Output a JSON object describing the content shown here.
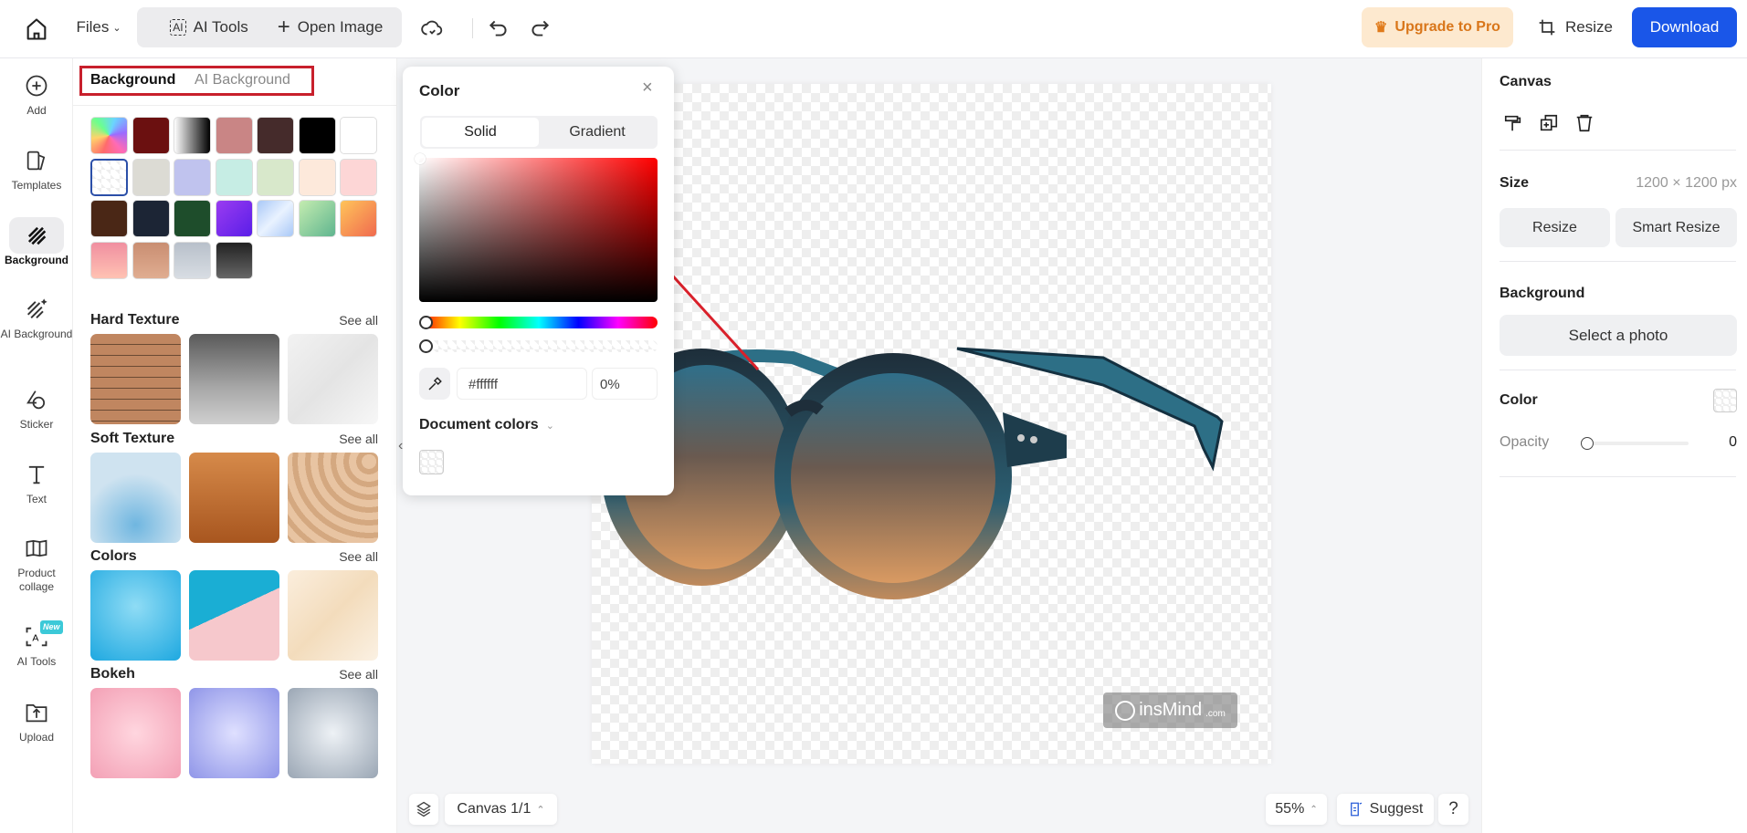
{
  "header": {
    "files": "Files",
    "ai_tools": "AI Tools",
    "open_image": "Open Image",
    "upgrade": "Upgrade to Pro",
    "resize": "Resize",
    "download": "Download"
  },
  "rail": [
    {
      "label": "Add"
    },
    {
      "label": "Templates"
    },
    {
      "label": "Background"
    },
    {
      "label": "AI Background"
    },
    {
      "label": "Sticker"
    },
    {
      "label": "Text"
    },
    {
      "label": "Product collage"
    },
    {
      "label": "AI Tools",
      "badge": "New"
    },
    {
      "label": "Upload"
    }
  ],
  "panel": {
    "tabs": [
      "Background",
      "AI Background"
    ],
    "swatches": [
      "conic-gradient(from 200deg,#ff6b6b,#ffd36b,#6bff8e,#6bd4ff,#9b6bff,#ff6bb5,#ff6b6b)",
      "#6b1010",
      "linear-gradient(90deg,#fff,#000)",
      "#c98585",
      "#452b2b",
      "#000000",
      "#ffffff",
      "transparent",
      "#dcdbd4",
      "#c0c3ee",
      "#c6ede4",
      "#d8e8cb",
      "#fde9db",
      "#fdd6d6",
      "#4a2716",
      "#1c2535",
      "#1e4d2b",
      "linear-gradient(135deg,#9a3cf0,#5a1ee8)",
      "linear-gradient(135deg,#a9c8f7,#e9f2ff,#a9c8f7)",
      "linear-gradient(135deg,#c4ecb0,#5fb58f)",
      "linear-gradient(135deg,#ffc45a,#f06a4f)",
      "linear-gradient(180deg,#f08fa0,#ffc2b3)",
      "linear-gradient(180deg,#c98e72,#e0ad91)",
      "linear-gradient(180deg,#b8c0ca,#d8dde3)",
      "linear-gradient(180deg,#222,#666)"
    ],
    "sections": [
      {
        "title": "Hard Texture",
        "see_all": "See all"
      },
      {
        "title": "Soft Texture",
        "see_all": "See all"
      },
      {
        "title": "Colors",
        "see_all": "See all"
      },
      {
        "title": "Bokeh",
        "see_all": "See all"
      }
    ]
  },
  "color_popup": {
    "title": "Color",
    "tabs": [
      "Solid",
      "Gradient"
    ],
    "hex": "#ffffff",
    "opacity": "0%",
    "document_colors": "Document colors",
    "hue": "#ff0000"
  },
  "canvas": {
    "watermark": "insMind",
    "watermark_suffix": ".com"
  },
  "bottom": {
    "canvas_pager": "Canvas 1/1",
    "zoom": "55%",
    "suggest": "Suggest",
    "help": "?"
  },
  "right": {
    "canvas": "Canvas",
    "size_label": "Size",
    "size_value": "1200 × 1200 px",
    "resize": "Resize",
    "smart_resize": "Smart Resize",
    "background": "Background",
    "select_photo": "Select a photo",
    "color": "Color",
    "opacity_label": "Opacity",
    "opacity_value": "0"
  },
  "colors": {
    "accent": "#1a56e8",
    "upgrade_bg": "#fde9cf",
    "upgrade_text": "#d9761a",
    "annotation": "#d9202a"
  }
}
